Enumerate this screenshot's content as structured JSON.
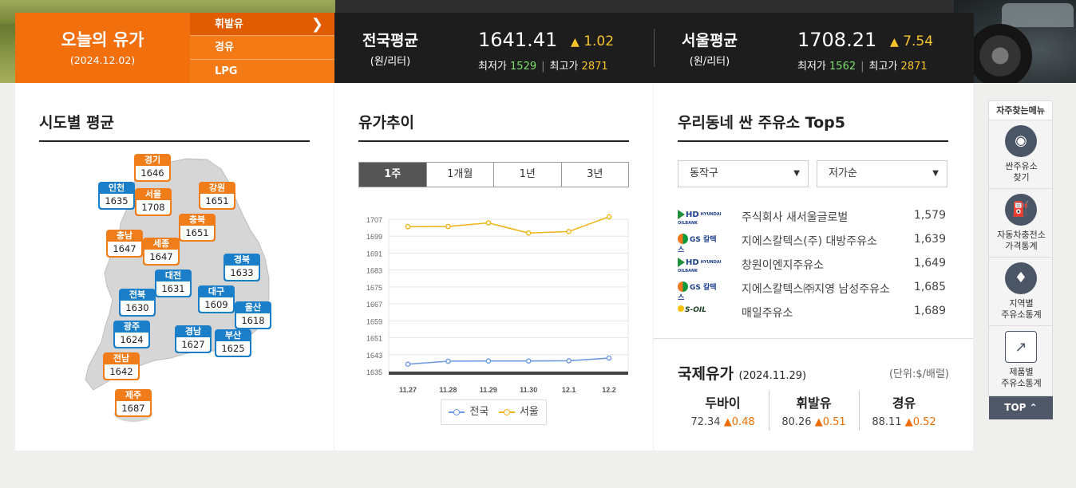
{
  "today": {
    "title": "오늘의 유가",
    "date": "(2024.12.02)"
  },
  "fuel_tabs": [
    {
      "label": "휘발유",
      "active": true
    },
    {
      "label": "경유",
      "active": false
    },
    {
      "label": "LPG",
      "active": false
    }
  ],
  "national": {
    "label": "전국평균",
    "unit": "(원/리터)",
    "price": "1641.41",
    "change": "1.02",
    "min_label": "최저가",
    "min": "1529",
    "max_label": "최고가",
    "max": "2871"
  },
  "seoul": {
    "label": "서울평균",
    "unit": "(원/리터)",
    "price": "1708.21",
    "change": "7.54",
    "min_label": "최저가",
    "min": "1562",
    "max_label": "최고가",
    "max": "2871"
  },
  "regional": {
    "title": "시도별 평균",
    "regions": [
      {
        "name": "경기",
        "value": "1646",
        "color": "orange"
      },
      {
        "name": "인천",
        "value": "1635",
        "color": "blue"
      },
      {
        "name": "서울",
        "value": "1708",
        "color": "orange"
      },
      {
        "name": "강원",
        "value": "1651",
        "color": "orange"
      },
      {
        "name": "충북",
        "value": "1651",
        "color": "orange"
      },
      {
        "name": "충남",
        "value": "1647",
        "color": "orange"
      },
      {
        "name": "세종",
        "value": "1647",
        "color": "orange"
      },
      {
        "name": "경북",
        "value": "1633",
        "color": "blue"
      },
      {
        "name": "대전",
        "value": "1631",
        "color": "blue"
      },
      {
        "name": "전북",
        "value": "1630",
        "color": "blue"
      },
      {
        "name": "대구",
        "value": "1609",
        "color": "blue"
      },
      {
        "name": "울산",
        "value": "1618",
        "color": "blue"
      },
      {
        "name": "광주",
        "value": "1624",
        "color": "blue"
      },
      {
        "name": "경남",
        "value": "1627",
        "color": "blue"
      },
      {
        "name": "부산",
        "value": "1625",
        "color": "blue"
      },
      {
        "name": "전남",
        "value": "1642",
        "color": "orange"
      },
      {
        "name": "제주",
        "value": "1687",
        "color": "orange"
      }
    ]
  },
  "trend": {
    "title": "유가추이",
    "periods": [
      {
        "label": "1주",
        "active": true
      },
      {
        "label": "1개월",
        "active": false
      },
      {
        "label": "1년",
        "active": false
      },
      {
        "label": "3년",
        "active": false
      }
    ]
  },
  "chart_data": {
    "type": "line",
    "x": [
      "11.27",
      "11.28",
      "11.29",
      "11.30",
      "12.1",
      "12.2"
    ],
    "series": [
      {
        "name": "전국",
        "color": "#6e9be0",
        "values": [
          1638.5,
          1639.9,
          1640.0,
          1640.0,
          1640.1,
          1641.4
        ]
      },
      {
        "name": "서울",
        "color": "#f0b419",
        "values": [
          1703.5,
          1703.6,
          1705.3,
          1700.5,
          1701.2,
          1708.2
        ]
      }
    ],
    "yticks": [
      1707,
      1699,
      1691,
      1683,
      1675,
      1667,
      1659,
      1651,
      1643,
      1635
    ],
    "ylim": [
      1635,
      1707
    ],
    "legend": "bottom"
  },
  "top5": {
    "title": "우리동네 싼 주유소 Top5",
    "district": "동작구",
    "sort": "저가순",
    "stations": [
      {
        "brand": "HD",
        "brand_sub": "HYUNDAI OILBANK",
        "name": "주식회사 새서울글로벌",
        "price": "1,579"
      },
      {
        "brand": "GS",
        "brand_sub": "칼텍스",
        "name": "지에스칼텍스(주) 대방주유소",
        "price": "1,639"
      },
      {
        "brand": "HD",
        "brand_sub": "HYUNDAI OILBANK",
        "name": "창원이엔지주유소",
        "price": "1,649"
      },
      {
        "brand": "GS",
        "brand_sub": "칼텍스",
        "name": "지에스칼텍스㈜지영 남성주유소",
        "price": "1,685"
      },
      {
        "brand": "S-OIL",
        "brand_sub": "",
        "name": "매일주유소",
        "price": "1,689"
      }
    ]
  },
  "intl": {
    "title": "국제유가",
    "date": "(2024.11.29)",
    "unit": "(단위:$/배럴)",
    "oils": [
      {
        "name": "두바이",
        "value": "72.34",
        "change": "0.48"
      },
      {
        "name": "휘발유",
        "value": "80.26",
        "change": "0.51"
      },
      {
        "name": "경유",
        "value": "88.11",
        "change": "0.52"
      }
    ]
  },
  "quick_menu": {
    "title": "자주찾는메뉴",
    "items": [
      {
        "label": "싼주유소\n찾기",
        "icon": "location-pin-icon"
      },
      {
        "label": "자동차충전소\n가격통계",
        "icon": "charging-station-icon"
      },
      {
        "label": "지역별\n주유소통계",
        "icon": "korea-map-icon"
      },
      {
        "label": "제품별\n주유소통계",
        "icon": "line-chart-icon"
      }
    ],
    "top": "TOP"
  }
}
